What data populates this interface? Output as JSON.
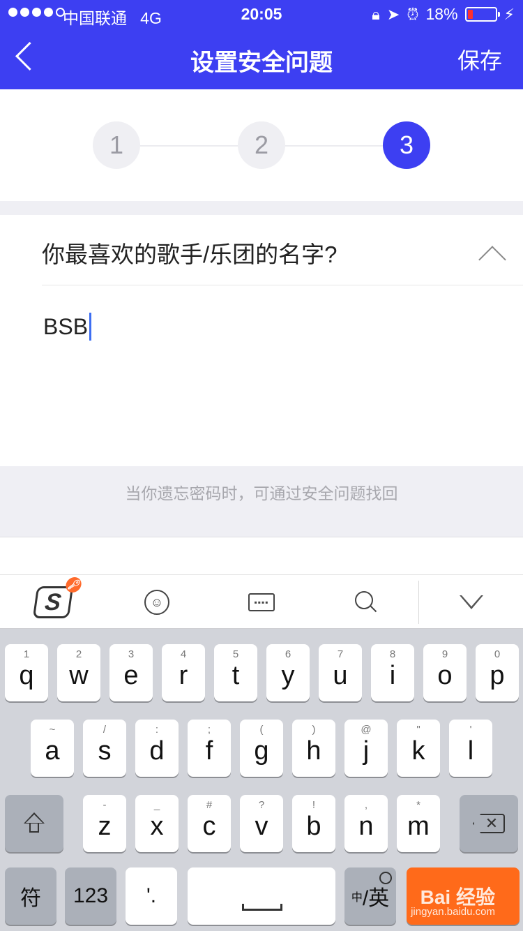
{
  "status_bar": {
    "carrier": "中国联通",
    "network": "4G",
    "time": "20:05",
    "battery_percent": "18%",
    "battery_level": 0.18,
    "battery_color": "#ff3030"
  },
  "nav": {
    "title": "设置安全问题",
    "save_label": "保存",
    "bg_color": "#3d3ff2"
  },
  "steps": {
    "items": [
      "1",
      "2",
      "3"
    ],
    "active_index": 2
  },
  "question": {
    "text": "你最喜欢的歌手/乐团的名字?",
    "answer": "BSB"
  },
  "hint": "当你遗忘密码时，可通过安全问题找回",
  "toolbar": {
    "icons": [
      "sogou-logo-icon",
      "emoji-icon",
      "keyboard-icon",
      "search-icon",
      "collapse-keyboard-icon"
    ]
  },
  "keyboard": {
    "row1": [
      {
        "main": "q",
        "sub": "1"
      },
      {
        "main": "w",
        "sub": "2"
      },
      {
        "main": "e",
        "sub": "3"
      },
      {
        "main": "r",
        "sub": "4"
      },
      {
        "main": "t",
        "sub": "5"
      },
      {
        "main": "y",
        "sub": "6"
      },
      {
        "main": "u",
        "sub": "7"
      },
      {
        "main": "i",
        "sub": "8"
      },
      {
        "main": "o",
        "sub": "9"
      },
      {
        "main": "p",
        "sub": "0"
      }
    ],
    "row2": [
      {
        "main": "a",
        "sub": "~"
      },
      {
        "main": "s",
        "sub": "/"
      },
      {
        "main": "d",
        "sub": ":"
      },
      {
        "main": "f",
        "sub": ";"
      },
      {
        "main": "g",
        "sub": "("
      },
      {
        "main": "h",
        "sub": ")"
      },
      {
        "main": "j",
        "sub": "@"
      },
      {
        "main": "k",
        "sub": "\""
      },
      {
        "main": "l",
        "sub": "'"
      }
    ],
    "row3": [
      {
        "main": "z",
        "sub": "-"
      },
      {
        "main": "x",
        "sub": "_"
      },
      {
        "main": "c",
        "sub": "#"
      },
      {
        "main": "v",
        "sub": "?"
      },
      {
        "main": "b",
        "sub": "!"
      },
      {
        "main": "n",
        "sub": ","
      },
      {
        "main": "m",
        "sub": "*"
      }
    ],
    "symbol_label": "符",
    "numbers_label": "123",
    "punct_label": "'.",
    "lang_zh": "中",
    "lang_en": "/英"
  },
  "watermark": {
    "brand": "Bai 经验",
    "url": "jingyan.baidu.com"
  }
}
